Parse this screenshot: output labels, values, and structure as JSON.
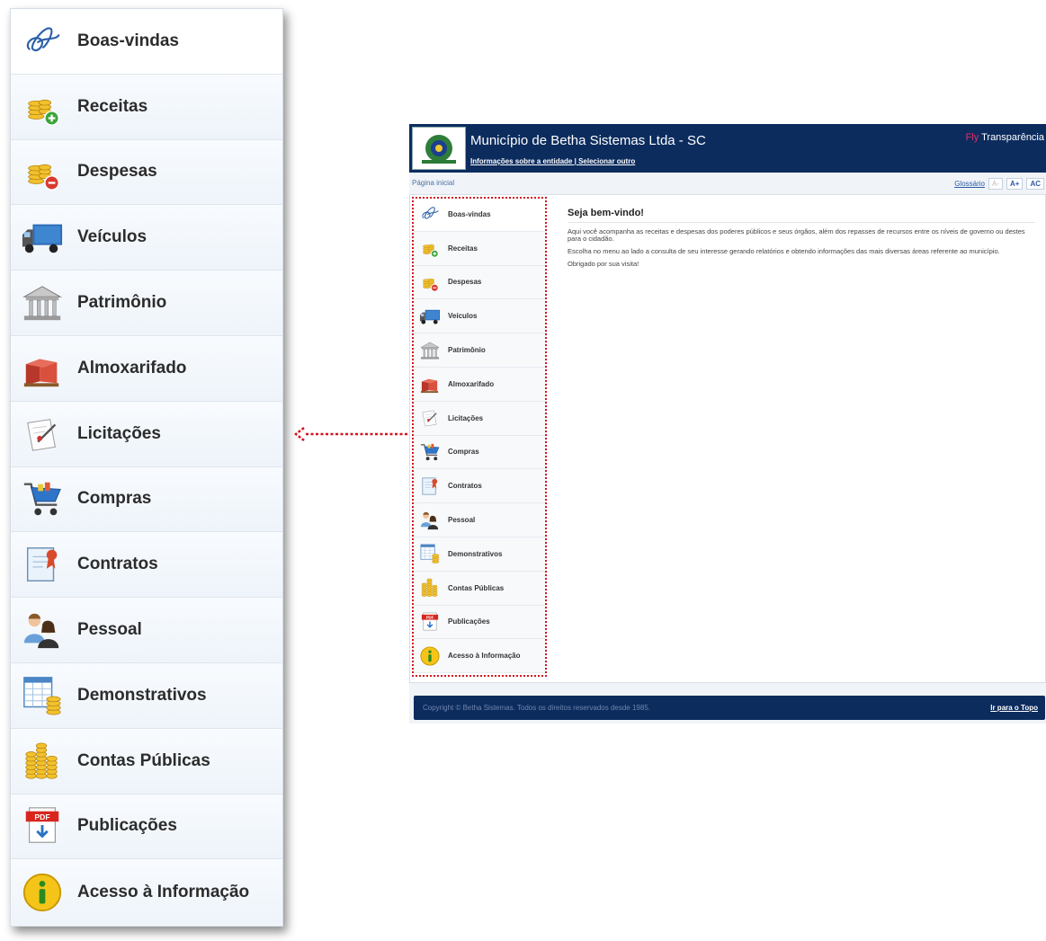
{
  "menu": {
    "items": [
      {
        "label": "Boas-vindas",
        "icon": "signature-icon"
      },
      {
        "label": "Receitas",
        "icon": "coins-plus-icon"
      },
      {
        "label": "Despesas",
        "icon": "coins-minus-icon"
      },
      {
        "label": "Veículos",
        "icon": "truck-icon"
      },
      {
        "label": "Patrimônio",
        "icon": "building-icon"
      },
      {
        "label": "Almoxarifado",
        "icon": "boxes-icon"
      },
      {
        "label": "Licitações",
        "icon": "document-pen-icon"
      },
      {
        "label": "Compras",
        "icon": "shopping-cart-icon"
      },
      {
        "label": "Contratos",
        "icon": "certificate-icon"
      },
      {
        "label": "Pessoal",
        "icon": "people-icon"
      },
      {
        "label": "Demonstrativos",
        "icon": "spreadsheet-coins-icon"
      },
      {
        "label": "Contas Públicas",
        "icon": "coin-stacks-icon"
      },
      {
        "label": "Publicações",
        "icon": "pdf-icon"
      },
      {
        "label": "Acesso à Informação",
        "icon": "info-icon"
      }
    ]
  },
  "mini": {
    "header": {
      "title": "Município de Betha Sistemas Ltda - SC",
      "info_link": "Informações sobre a entidade",
      "separator": "|",
      "select_link": "Selecionar outro",
      "brand_fly": "Fly",
      "brand_name": "Transparência"
    },
    "breadcrumb": "Página inicial",
    "tools": {
      "glossario": "Glossário",
      "font_decrease": "A-",
      "font_increase": "A+",
      "contrast": "AC"
    },
    "welcome": {
      "heading": "Seja bem-vindo!",
      "paragraph1": "Aqui você acompanha as receitas e despesas dos poderes públicos e seus órgãos, além dos repasses de recursos entre os níveis de governo ou destes para o cidadão.",
      "paragraph2": "Escolha no menu ao lado a consulta de seu interesse gerando relatórios e obtendo informações das mais diversas áreas referente ao município.",
      "paragraph3": "Obrigado por sua visita!"
    },
    "footer": {
      "copyright": "Copyright © Betha Sistemas. Todos os direitos reservados desde 1985.",
      "back_to_top": "Ir para o Topo"
    }
  },
  "colors": {
    "header_bg": "#0c2c5e",
    "highlight_border": "#d3141e",
    "brand_fly": "#e0306a"
  }
}
